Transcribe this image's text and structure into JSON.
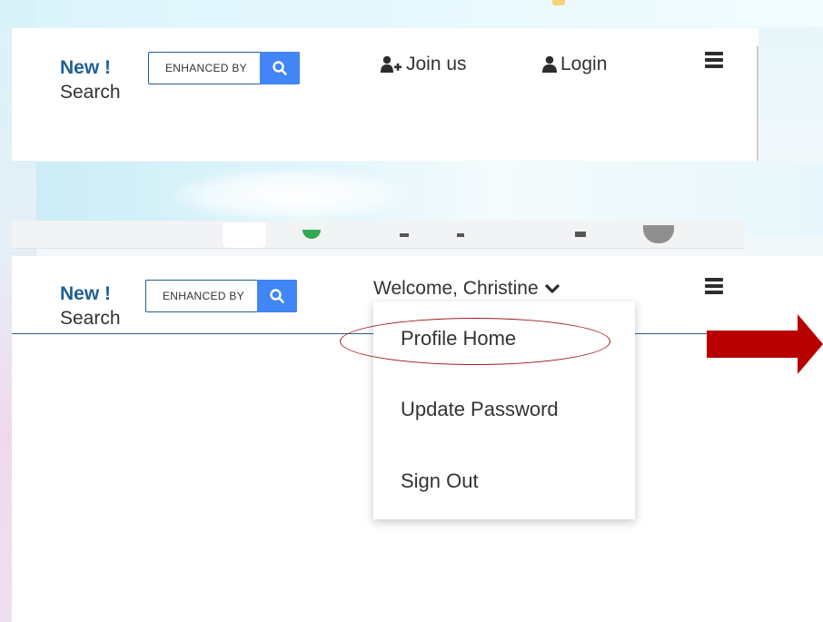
{
  "header_logged_out": {
    "new_label": "New !",
    "search_label": "Search",
    "search_placeholder": "ENHANCED BY",
    "search_icon": "search-icon",
    "join_label": "Join us",
    "join_icon": "user-plus-icon",
    "login_label": "Login",
    "login_icon": "user-icon",
    "menu_icon": "hamburger-menu-icon"
  },
  "header_logged_in": {
    "new_label": "New !",
    "search_label": "Search",
    "search_placeholder": "ENHANCED BY",
    "search_icon": "search-icon",
    "welcome_label": "Welcome, Christine",
    "welcome_icon": "chevron-down-icon",
    "menu_icon": "hamburger-menu-icon"
  },
  "dropdown": {
    "items": [
      {
        "label": "Profile Home",
        "highlighted": true
      },
      {
        "label": "Update Password"
      },
      {
        "label": "Sign Out"
      }
    ]
  },
  "annotation": {
    "highlight_color": "#a21c1c",
    "arrow_color": "#b80000"
  },
  "colors": {
    "brand_blue": "#1f5f95",
    "search_button": "#4285f4"
  }
}
